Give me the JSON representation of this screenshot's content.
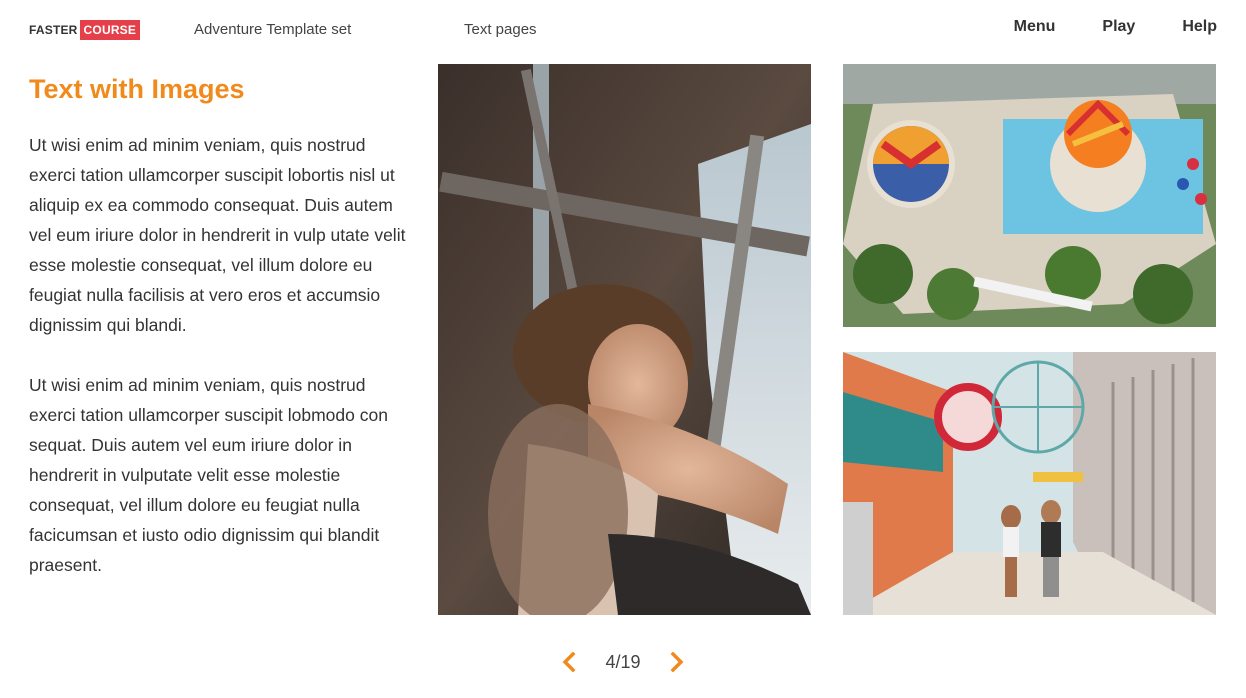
{
  "header": {
    "logo": {
      "part1": "FASTER",
      "part2": "COURSE"
    },
    "course_title": "Adventure Template set",
    "section_title": "Text pages",
    "nav": [
      {
        "label": "Menu"
      },
      {
        "label": "Play"
      },
      {
        "label": "Help"
      }
    ]
  },
  "content": {
    "title": "Text with Images",
    "paragraphs": [
      "Ut wisi enim ad minim veniam, quis nostrud exerci tation ullamcorper suscipit lobortis nisl ut aliquip ex ea commodo consequat. Duis autem vel eum iriure dolor in hendrerit in vulp utate velit esse molestie consequat, vel illum dolore eu feugiat nulla facilisis at vero eros et accumsio dignissim qui blandi.",
      "Ut wisi enim ad minim veniam, quis nostrud exerci tation ullamcorper suscipit lobmodo con sequat. Duis autem vel eum iriure dolor in hendrerit in vulputate velit esse molestie consequat, vel illum dolore eu feugiat nulla facicumsan et iusto odio dignissim qui blandit praesent."
    ]
  },
  "pagination": {
    "text": "4/19",
    "prev_icon": "chevron-left-icon",
    "next_icon": "chevron-right-icon"
  },
  "colors": {
    "accent": "#f08a1c",
    "logo_red": "#e5404a",
    "text": "#333333"
  }
}
